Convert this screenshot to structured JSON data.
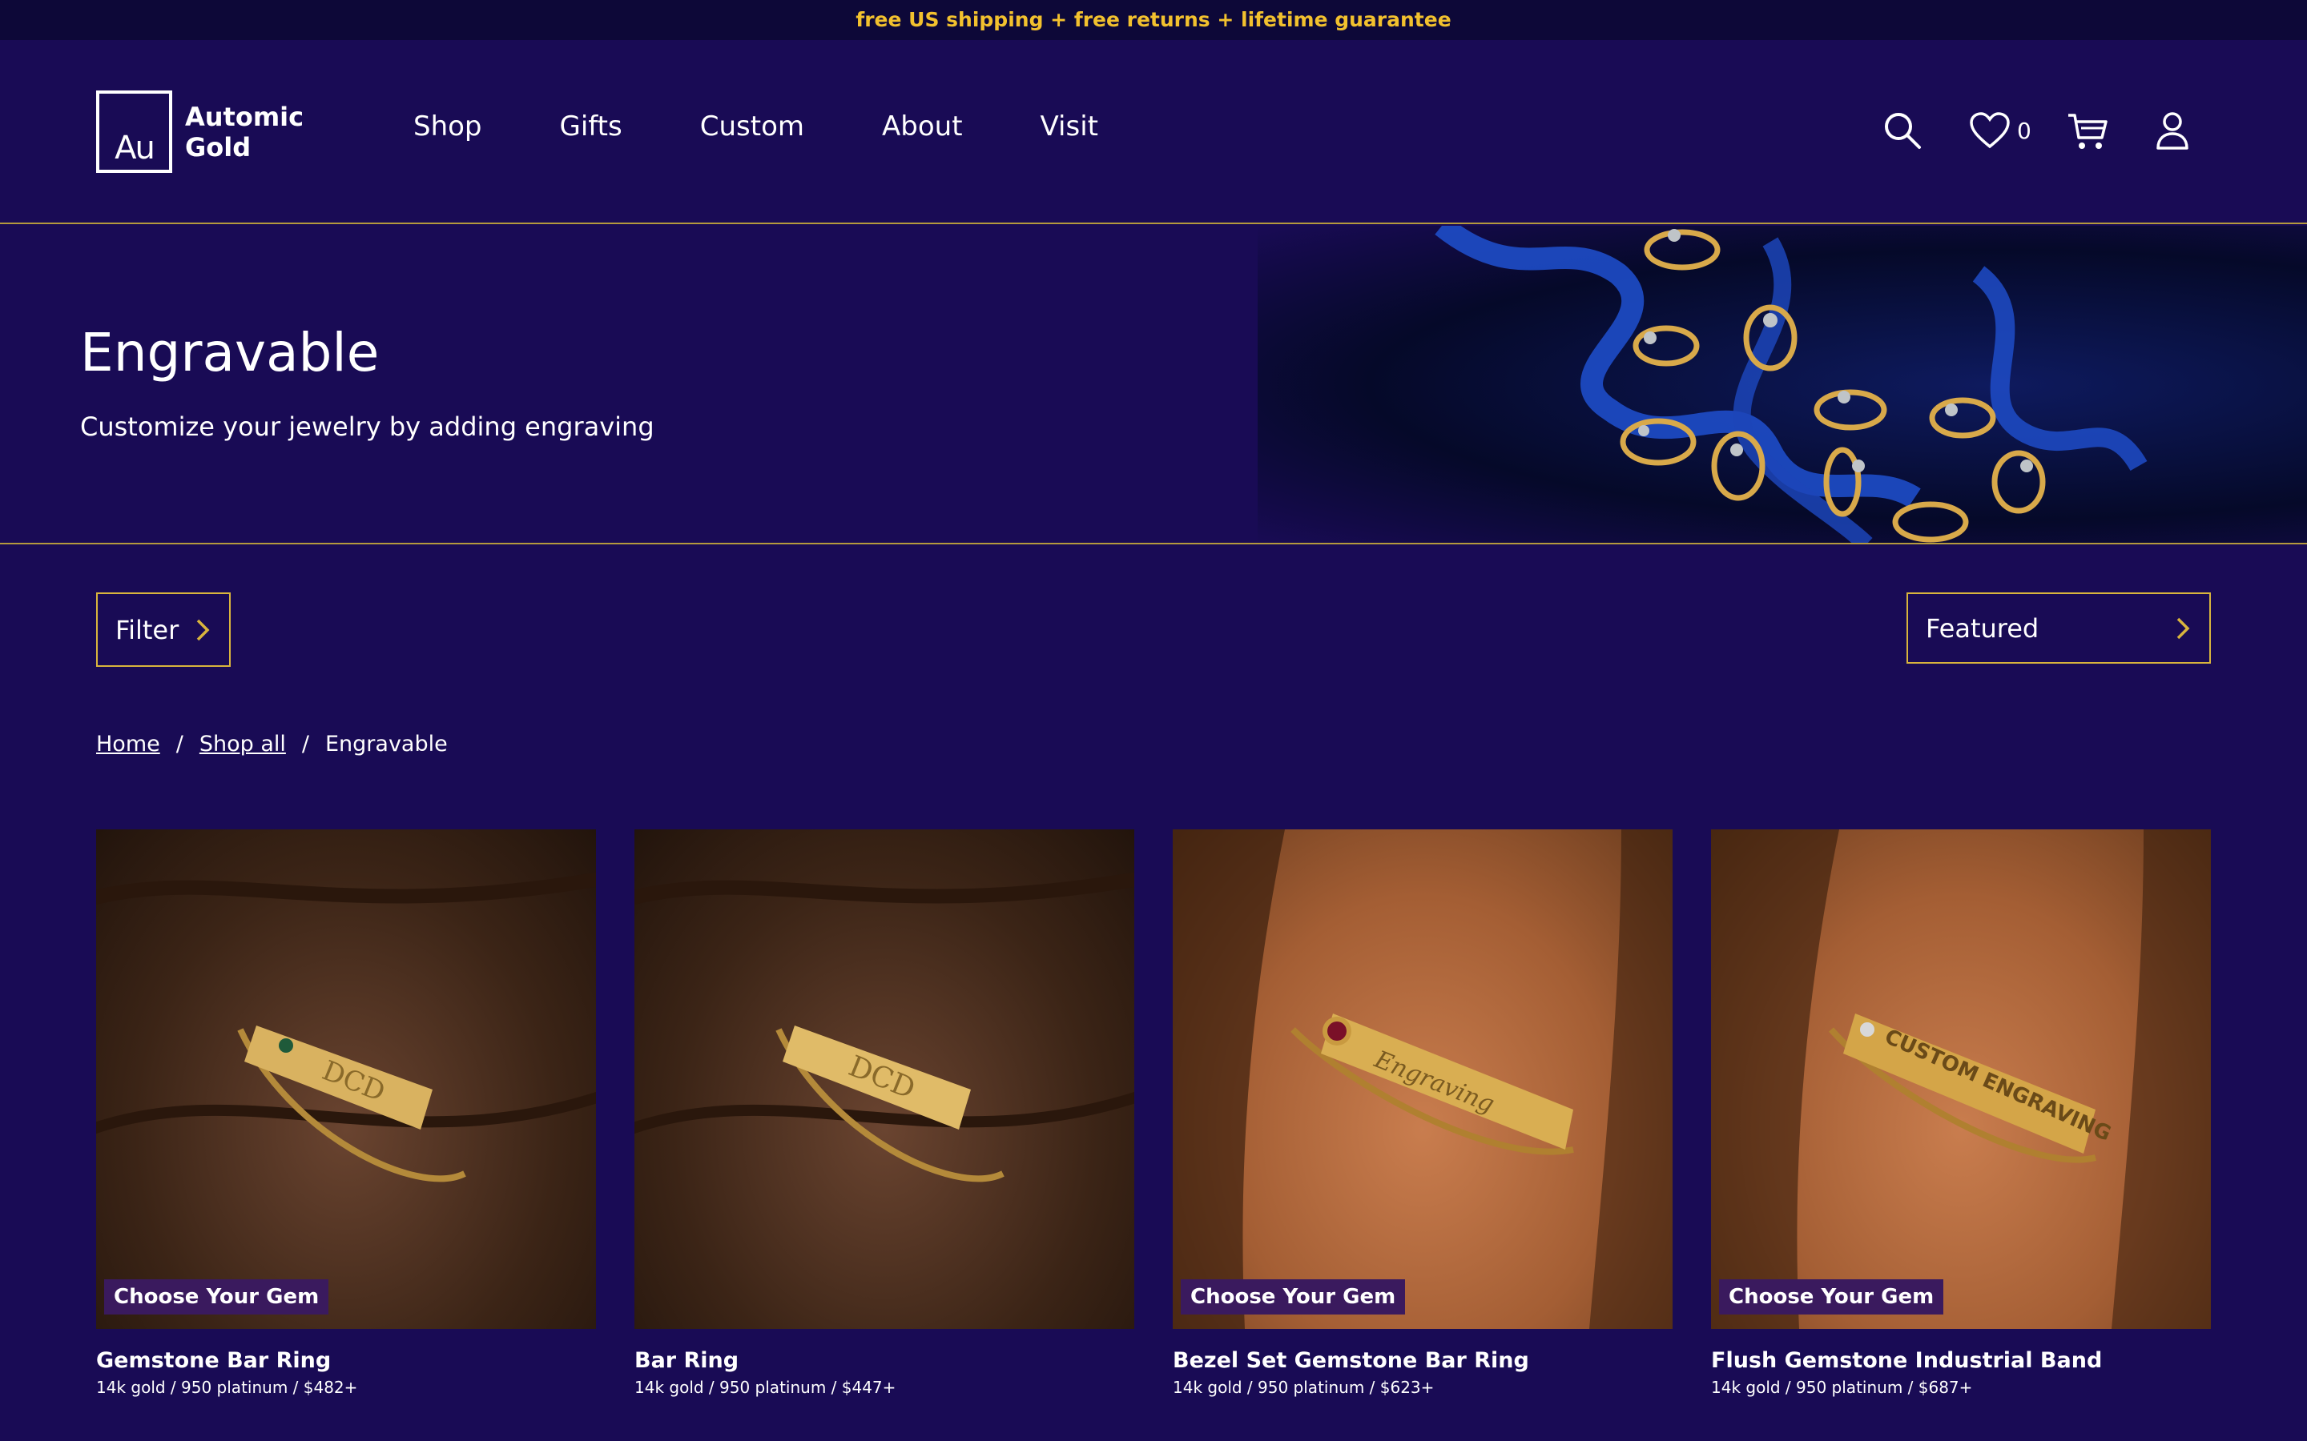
{
  "announcement": "free US shipping + free returns + lifetime guarantee",
  "logo": {
    "mark": "Au",
    "line1": "Automic",
    "line2": "Gold"
  },
  "nav": [
    "Shop",
    "Gifts",
    "Custom",
    "About",
    "Visit"
  ],
  "header_icons": {
    "search": "search-icon",
    "wishlist": "heart-icon",
    "wishlist_count": "0",
    "cart": "cart-icon",
    "account": "user-icon"
  },
  "hero": {
    "title": "Engravable",
    "subtitle": "Customize your jewelry by adding engraving"
  },
  "controls": {
    "filter_label": "Filter",
    "sort_label": "Featured"
  },
  "breadcrumb": {
    "home": "Home",
    "shop_all": "Shop all",
    "current": "Engravable",
    "sep": "/"
  },
  "products": [
    {
      "title": "Gemstone Bar Ring",
      "meta": "14k gold  / 950 platinum  /  $482+",
      "badge": "Choose Your Gem"
    },
    {
      "title": "Bar Ring",
      "meta": "14k gold  / 950 platinum  /  $447+",
      "badge": ""
    },
    {
      "title": "Bezel Set Gemstone Bar Ring",
      "meta": "14k gold  / 950 platinum  /  $623+",
      "badge": "Choose Your Gem"
    },
    {
      "title": "Flush Gemstone Industrial Band",
      "meta": "14k gold  / 950 platinum  /  $687+",
      "badge": "Choose Your Gem"
    }
  ],
  "colors": {
    "background": "#190b55",
    "accent": "#d9b53d",
    "announce_text": "#f2c12e"
  }
}
